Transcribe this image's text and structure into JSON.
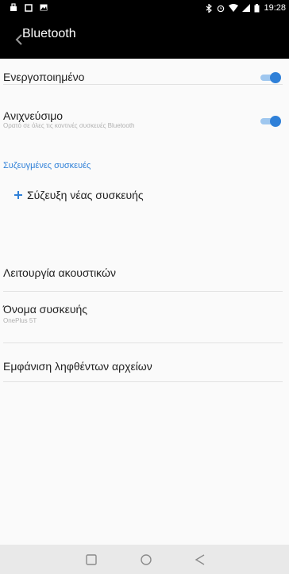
{
  "status_bar": {
    "time": "19:28"
  },
  "toolbar": {
    "title": "Bluetooth"
  },
  "settings": {
    "enabled_label": "Ενεργοποιημένο",
    "enabled_on": true,
    "discoverable_label": "Ανιχνεύσιμο",
    "discoverable_sub": "Ορατό σε όλες τις κοντινές συσκευές Bluetooth",
    "discoverable_on": true,
    "paired_header": "Συζευγμένες συσκευές",
    "pair_new_label": "Σύζευξη νέας συσκευής",
    "audio_mode_label": "Λειτουργία ακουστικών",
    "device_name_label": "Όνομα συσκευής",
    "device_name_value": "OnePlus 5T",
    "received_files_label": "Εμφάνιση ληφθέντων αρχείων"
  },
  "colors": {
    "accent": "#2f80d8",
    "toolbar_bg": "#000000",
    "page_bg": "#fafafa"
  }
}
